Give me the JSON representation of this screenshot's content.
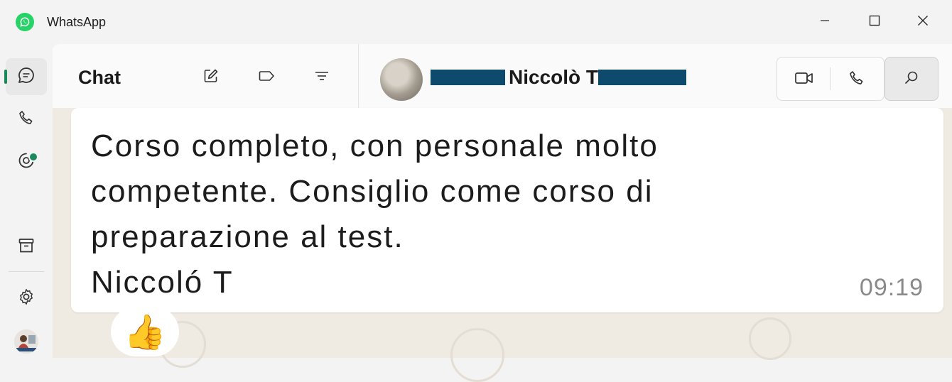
{
  "app": {
    "title": "WhatsApp"
  },
  "sidebar": {
    "items": [
      {
        "icon": "chats-icon"
      },
      {
        "icon": "calls-icon"
      },
      {
        "icon": "status-icon"
      },
      {
        "icon": "archive-icon"
      },
      {
        "icon": "settings-icon"
      },
      {
        "icon": "profile-avatar"
      }
    ]
  },
  "chat_list": {
    "title": "Chat"
  },
  "conversation": {
    "contact_name": "Niccolò T",
    "message": {
      "text": "Corso completo, con personale molto\ncompetente. Consiglio come corso di\npreparazione al test.\nNiccoló T",
      "time": "09:19"
    },
    "reaction": "👍"
  },
  "colors": {
    "accent": "#1a8a5a",
    "brand": "#25d366",
    "redaction": "#0e4a6b"
  }
}
